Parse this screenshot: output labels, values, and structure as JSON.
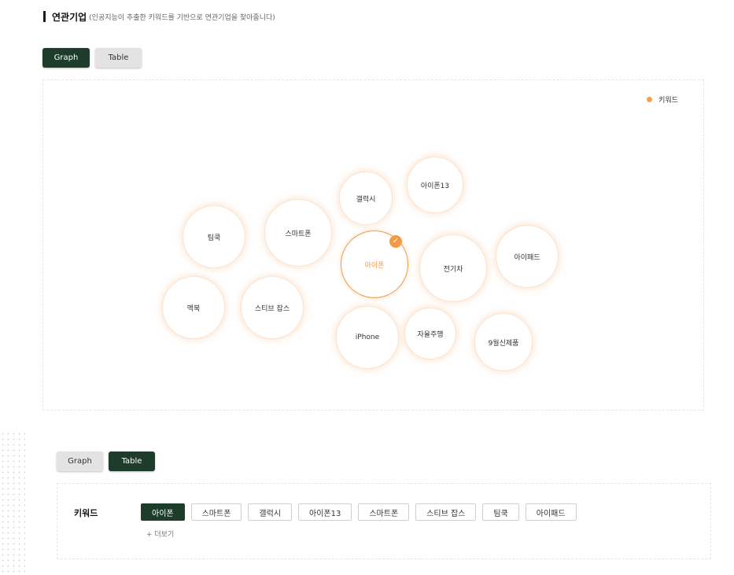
{
  "section": {
    "title": "연관기업",
    "subtitle": "(인공지능이 추출한 키워드를 기반으로 연관기업을 찾아줍니다)"
  },
  "top_tabs": {
    "graph": "Graph",
    "table": "Table",
    "active": "graph"
  },
  "legend": {
    "label": "키워드",
    "color": "#f7a04b"
  },
  "bubbles": {
    "iphone_kr": "아이폰",
    "galaxy": "갤럭시",
    "iphone13": "아이폰13",
    "teamcook": "팀쿡",
    "smartphone": "스마트폰",
    "ev": "전기차",
    "ipad": "아이패드",
    "macbook": "맥북",
    "steve_jobs": "스티브 잡스",
    "iphone_en": "iPhone",
    "autonomous": "자율주행",
    "sept_new": "9월신제품"
  },
  "selected_bubble": "아이폰",
  "bottom_tabs": {
    "graph": "Graph",
    "table": "Table",
    "active": "table"
  },
  "table": {
    "keyword_label": "키워드",
    "chips": [
      "아이폰",
      "스마트폰",
      "갤럭시",
      "아이폰13",
      "스마트폰",
      "스티브 잡스",
      "팀쿡",
      "아이패드"
    ],
    "active_chip_index": 0,
    "more_label": "+ 더보기"
  },
  "colors": {
    "accent": "#f39a43",
    "dark_green": "#1d3d2a"
  }
}
